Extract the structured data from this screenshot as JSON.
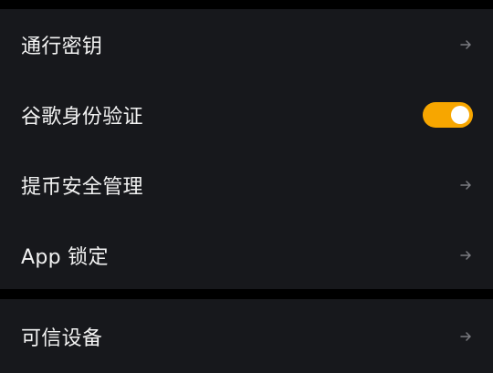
{
  "theme": {
    "background": "#000000",
    "card": "#17181c",
    "text": "#f2f2f2",
    "arrow": "#7a7b80",
    "accent": "#f7a600"
  },
  "security": {
    "group1": [
      {
        "label": "通行密钥",
        "control": "arrow-right-icon"
      },
      {
        "label": "谷歌身份验证",
        "control": "toggle",
        "enabled": true
      },
      {
        "label": "提币安全管理",
        "control": "arrow-right-icon"
      },
      {
        "label": "App 锁定",
        "control": "arrow-right-icon"
      }
    ],
    "group2": [
      {
        "label": "可信设备",
        "control": "arrow-right-icon"
      }
    ]
  }
}
